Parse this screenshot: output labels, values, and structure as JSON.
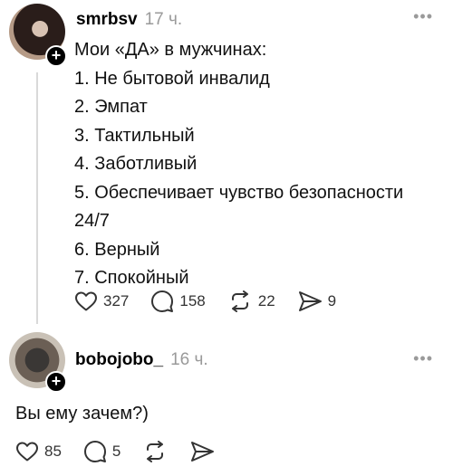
{
  "posts": [
    {
      "username": "smrbsv",
      "time": "17 ч.",
      "lines": [
        "Мои «ДА» в мужчинах:",
        "1. Не бытовой инвалид",
        "2. Эмпат",
        "3. Тактильный",
        "4. Заботливый",
        "5. Обеспечивает чувство безопасности",
        "24/7",
        "6. Верный",
        "7. Спокойный"
      ],
      "likes": "327",
      "replies": "158",
      "reposts": "22",
      "shares": "9"
    },
    {
      "username": "bobojobo_",
      "time": "16 ч.",
      "lines": [
        "Вы ему зачем?)"
      ],
      "likes": "85",
      "replies": "5",
      "reposts": "",
      "shares": ""
    }
  ],
  "icons": {
    "more": "more-dots-icon",
    "like": "heart-icon",
    "reply": "comment-icon",
    "repost": "repost-icon",
    "share": "send-icon",
    "follow": "plus-icon"
  }
}
